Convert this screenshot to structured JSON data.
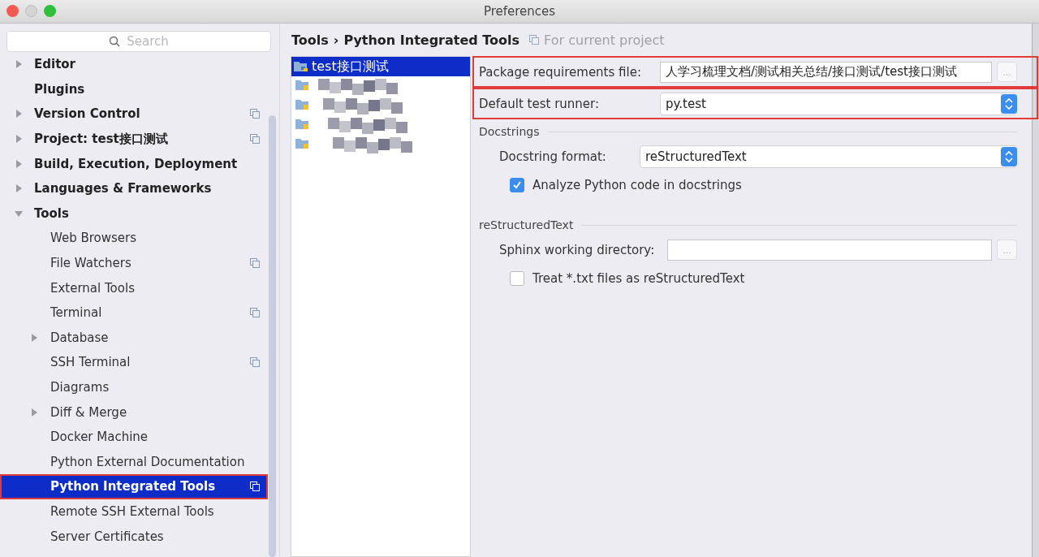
{
  "window": {
    "title": "Preferences"
  },
  "search": {
    "placeholder": "Search"
  },
  "sidebar": {
    "items": [
      {
        "label": "Editor",
        "expanded": false,
        "shared": false,
        "selected": false,
        "highlighted": false
      },
      {
        "label": "Plugins",
        "shared": false,
        "selected": false,
        "highlighted": false
      },
      {
        "label": "Version Control",
        "expanded": false,
        "shared": true,
        "selected": false,
        "highlighted": false
      },
      {
        "label": "Project: test接口测试",
        "expanded": false,
        "shared": true,
        "selected": false,
        "highlighted": false
      },
      {
        "label": "Build, Execution, Deployment",
        "expanded": false,
        "shared": false,
        "selected": false,
        "highlighted": false
      },
      {
        "label": "Languages & Frameworks",
        "expanded": false,
        "shared": false,
        "selected": false,
        "highlighted": false
      },
      {
        "label": "Tools",
        "expanded": true,
        "shared": false,
        "selected": false,
        "highlighted": false,
        "children": [
          {
            "label": "Web Browsers",
            "shared": false,
            "selected": false,
            "highlighted": false
          },
          {
            "label": "File Watchers",
            "shared": true,
            "selected": false,
            "highlighted": false
          },
          {
            "label": "External Tools",
            "shared": false,
            "selected": false,
            "highlighted": false
          },
          {
            "label": "Terminal",
            "shared": true,
            "selected": false,
            "highlighted": false
          },
          {
            "label": "Database",
            "expanded": false,
            "shared": false,
            "selected": false,
            "highlighted": false
          },
          {
            "label": "SSH Terminal",
            "shared": true,
            "selected": false,
            "highlighted": false
          },
          {
            "label": "Diagrams",
            "shared": false,
            "selected": false,
            "highlighted": false
          },
          {
            "label": "Diff & Merge",
            "expanded": false,
            "shared": false,
            "selected": false,
            "highlighted": false
          },
          {
            "label": "Docker Machine",
            "shared": false,
            "selected": false,
            "highlighted": false
          },
          {
            "label": "Python External Documentation",
            "shared": false,
            "selected": false,
            "highlighted": false
          },
          {
            "label": "Python Integrated Tools",
            "shared": true,
            "selected": true,
            "highlighted": true
          },
          {
            "label": "Remote SSH External Tools",
            "shared": false,
            "selected": false,
            "highlighted": false
          },
          {
            "label": "Server Certificates",
            "shared": false,
            "selected": false,
            "highlighted": false
          }
        ]
      }
    ]
  },
  "breadcrumb": {
    "parts": [
      "Tools",
      "Python Integrated Tools"
    ],
    "separator": "›",
    "scope": "For current project"
  },
  "projects": [
    {
      "kind": "named",
      "label": "test接口测试",
      "selected": true
    },
    {
      "kind": "pixelated",
      "selected": false
    },
    {
      "kind": "pixelated",
      "selected": false
    },
    {
      "kind": "pixelated",
      "selected": false
    },
    {
      "kind": "pixelated",
      "selected": false
    }
  ],
  "top_rows": [
    {
      "kind": "path",
      "label": "Package requirements file:",
      "value": "人学习梳理文档/测试相关总结/接口测试/test接口测试",
      "button": "…",
      "highlighted": true
    },
    {
      "kind": "select",
      "label": "Default test runner:",
      "value": "py.test",
      "highlighted": true
    }
  ],
  "sections": [
    {
      "title": "Docstrings",
      "rows": [
        {
          "kind": "select",
          "label": "Docstring format:",
          "value": "reStructuredText"
        },
        {
          "kind": "checkbox",
          "label": "Analyze Python code in docstrings",
          "checked": true
        }
      ]
    },
    {
      "title": "reStructuredText",
      "rows": [
        {
          "kind": "path",
          "label": "Sphinx working directory:",
          "value": "",
          "button": "…"
        },
        {
          "kind": "checkbox",
          "label": "Treat *.txt files as reStructuredText",
          "checked": false
        }
      ]
    }
  ]
}
